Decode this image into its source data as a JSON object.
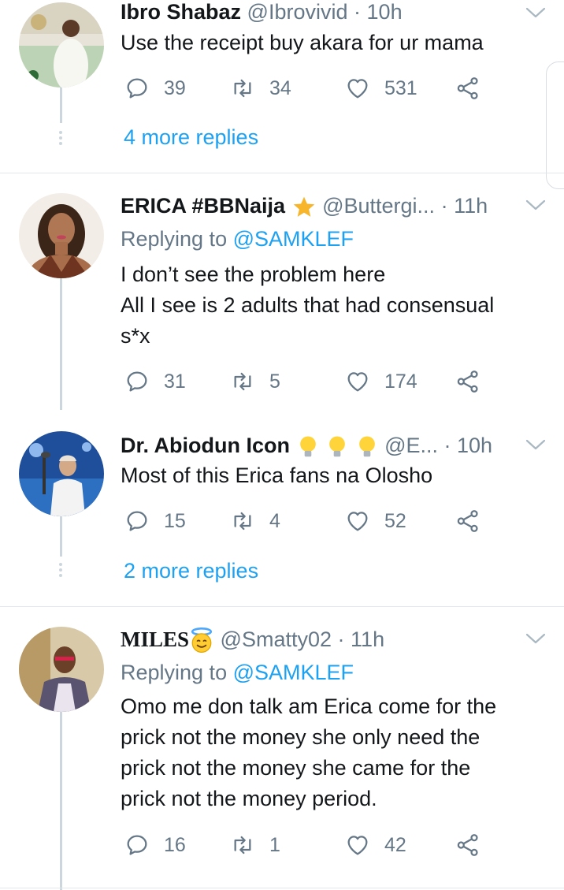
{
  "tweets": [
    {
      "name": "Ibro Shabaz",
      "handle": "@Ibrovivid",
      "time": "10h",
      "body": [
        "Use the receipt buy akara for ur mama"
      ],
      "replies": "39",
      "retweets": "34",
      "likes": "531",
      "more_replies": "4 more replies"
    },
    {
      "name": "ERICA #BBNaija",
      "handle": "@Buttergi...",
      "time": "11h",
      "replying_prefix": "Replying to ",
      "replying_to": "@SAMKLEF",
      "body": [
        "I don’t see the problem here",
        "All I see is 2 adults that had consensual",
        "s*x"
      ],
      "replies": "31",
      "retweets": "5",
      "likes": "174"
    },
    {
      "name": "Dr. Abiodun Icon",
      "handle": "@E...",
      "time": "10h",
      "body": [
        "Most of this Erica fans na Olosho"
      ],
      "replies": "15",
      "retweets": "4",
      "likes": "52",
      "more_replies": "2 more replies"
    },
    {
      "name": "MILES",
      "handle": "@Smatty02",
      "time": "11h",
      "replying_prefix": "Replying to ",
      "replying_to": "@SAMKLEF",
      "body": [
        "Omo me don talk am Erica come for the",
        "prick not the money she only need the",
        "prick not the money she came for the",
        "prick not the money period."
      ],
      "replies": "16",
      "retweets": "1",
      "likes": "42"
    }
  ],
  "sep": "·",
  "colors": {
    "accent": "#1da1f2",
    "muted": "#657786",
    "text": "#14171a",
    "thread": "#ccd6dd"
  },
  "icons": [
    "reply-icon",
    "retweet-icon",
    "like-icon",
    "share-icon",
    "chevron-down-icon",
    "star-emoji",
    "lightbulb-emoji",
    "smiling-halo-emoji"
  ]
}
